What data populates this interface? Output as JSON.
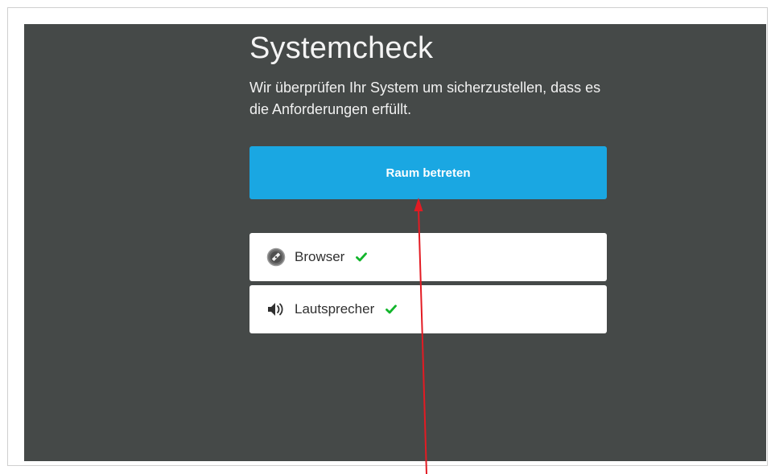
{
  "page": {
    "title": "Systemcheck",
    "subtitle": "Wir überprüfen Ihr System um sicherzustellen, dass es die Anforderungen erfüllt."
  },
  "actions": {
    "enter_room_label": "Raum betreten"
  },
  "checks": [
    {
      "label": "Browser",
      "icon": "compass-icon",
      "status": "passed"
    },
    {
      "label": "Lautsprecher",
      "icon": "speaker-icon",
      "status": "passed"
    }
  ],
  "colors": {
    "panel_background": "#454948",
    "button_background": "#1aa7e2",
    "check_green": "#12b52b",
    "annotation_arrow": "#e31b23"
  }
}
